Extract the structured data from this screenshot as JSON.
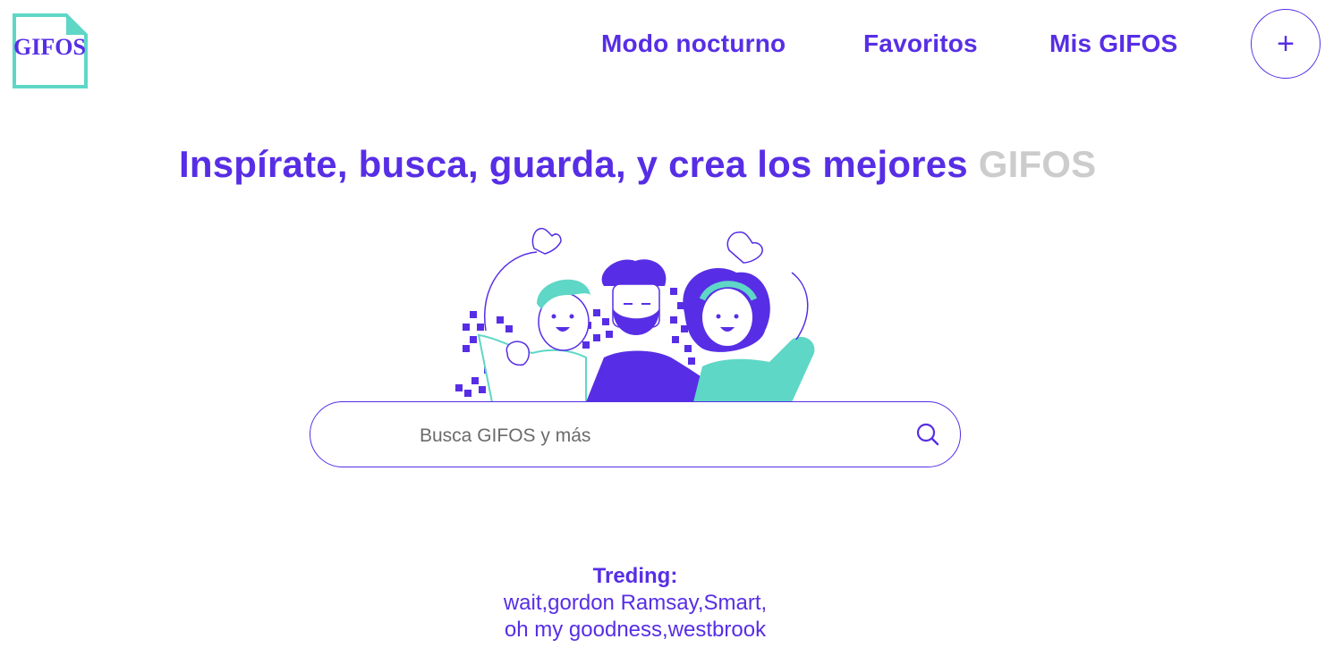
{
  "logo": {
    "text": "GIFOS",
    "frame_color": "#5ed7c6",
    "text_color": "#572ee5"
  },
  "nav": {
    "night_mode_label": "Modo nocturno",
    "favorites_label": "Favoritos",
    "my_gifos_label": "Mis GIFOS",
    "add_button_label": "+"
  },
  "hero": {
    "headline_main": "Inspírate, busca, guarda, y crea los mejores",
    "headline_accent": "GIFOS",
    "illustration_icon": "people-waving-illustration"
  },
  "search": {
    "placeholder": "Busca GIFOS y más",
    "value": "",
    "icon": "search-icon"
  },
  "trending": {
    "title": "Treding:",
    "line1": [
      {
        "text": "wait"
      },
      {
        "text": ","
      },
      {
        "text": "gordon Ramsay"
      },
      {
        "text": ","
      },
      {
        "text": "Smart"
      },
      {
        "text": ","
      }
    ],
    "line2": [
      {
        "text": "oh my goodness"
      },
      {
        "text": ","
      },
      {
        "text": "westbrook"
      }
    ]
  },
  "colors": {
    "primary": "#572ee5",
    "secondary": "#5ed7c6",
    "muted": "#cccccc"
  }
}
